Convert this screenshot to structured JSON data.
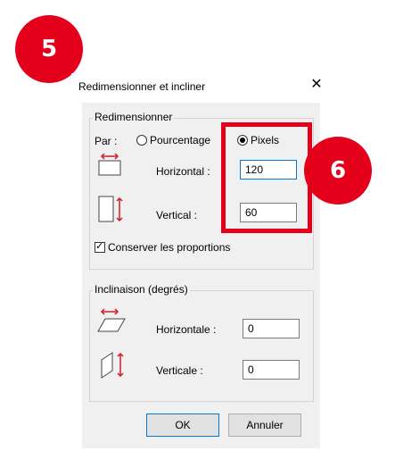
{
  "badges": {
    "step1": "5",
    "step2": "6"
  },
  "dialog": {
    "title": "Redimensionner et incliner",
    "close_icon": "close-icon"
  },
  "resize": {
    "legend": "Redimensionner",
    "by_label": "Par :",
    "percentage_label": "Pourcentage",
    "pixels_label": "Pixels",
    "selected": "Pixels",
    "horizontal_label": "Horizontal :",
    "horizontal_value": "120",
    "vertical_label": "Vertical :",
    "vertical_value": "60",
    "keep_ratio_label": "Conserver les proportions",
    "keep_ratio_checked": true
  },
  "skew": {
    "legend": "Inclinaison (degrés)",
    "horizontal_label": "Horizontale :",
    "horizontal_value": "0",
    "vertical_label": "Verticale :",
    "vertical_value": "0"
  },
  "buttons": {
    "ok": "OK",
    "cancel": "Annuler"
  },
  "colors": {
    "badge": "#e4001b",
    "highlight": "#e4001b",
    "focus": "#0078d7",
    "arrow": "#d11a2a"
  }
}
